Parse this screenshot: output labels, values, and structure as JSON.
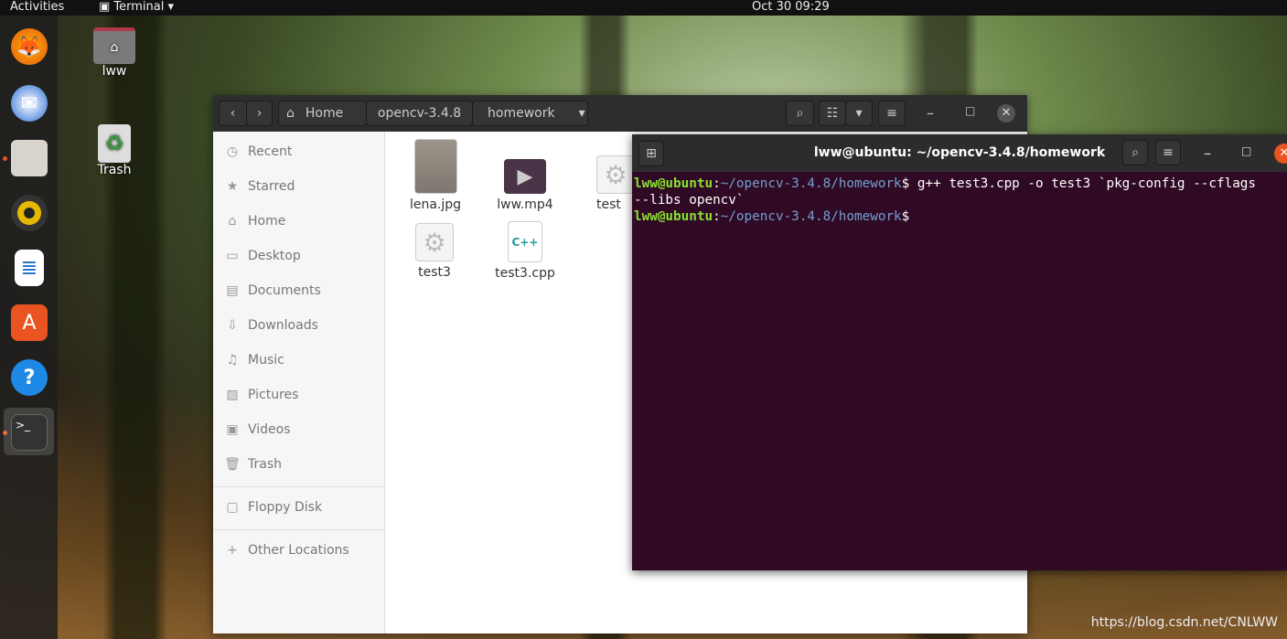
{
  "topbar": {
    "activities": "Activities",
    "app": "Terminal ▾",
    "clock": "Oct 30  09:29"
  },
  "dock": [
    "firefox-icon",
    "thunderbird-icon",
    "files-icon",
    "rhythmbox-icon",
    "writer-icon",
    "software-icon",
    "help-icon",
    "terminal-icon"
  ],
  "desktop": {
    "home": "lww",
    "trash": "Trash"
  },
  "files": {
    "path": [
      "Home",
      "opencv-3.4.8",
      "homework"
    ],
    "sidebar": [
      "Recent",
      "Starred",
      "Home",
      "Desktop",
      "Documents",
      "Downloads",
      "Music",
      "Pictures",
      "Videos",
      "Trash"
    ],
    "devices": [
      "Floppy Disk"
    ],
    "other": "Other Locations",
    "items": [
      "lena.jpg",
      "lww.mp4",
      "test",
      "test3",
      "test3.cpp"
    ],
    "cpp_badge": "C++"
  },
  "terminal": {
    "title": "lww@ubuntu: ~/opencv-3.4.8/homework",
    "user": "lww@ubuntu",
    "path": "~/opencv-3.4.8/homework",
    "command": "g++ test3.cpp -o test3 `pkg-config --cflags",
    "command_cont": "--libs opencv`"
  },
  "watermark": "https://blog.csdn.net/CNLWW",
  "colors": {
    "terminal_bg": "#300a24",
    "prompt_user": "#8ae234",
    "prompt_path": "#729fcf",
    "accent": "#e95420"
  }
}
